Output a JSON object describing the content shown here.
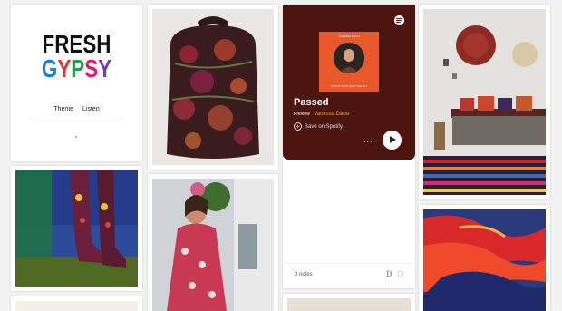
{
  "brand": {
    "line1": "FRESH",
    "line2_letters": [
      {
        "ch": "G",
        "color": "#1a7fd4"
      },
      {
        "ch": "Y",
        "color": "#e53131"
      },
      {
        "ch": "P",
        "color": "#2b9c4a"
      },
      {
        "ch": "S",
        "color": "#d71f7a"
      },
      {
        "ch": "Y",
        "color": "#6b3fb0"
      }
    ]
  },
  "nav": {
    "theme": "Theme",
    "listen": "Listen"
  },
  "spotify": {
    "album_top": "VANESSA DAOU",
    "album_bottom": "SUNNY DAYS FEAT THE HIT",
    "title": "Passed",
    "preview": "Preview",
    "artist": "Vanessa Daou",
    "save": "Save on Spotify",
    "more": "...",
    "accent": "#4c1510"
  },
  "post": {
    "notes": "3 notes",
    "reblog_glyph": "D"
  }
}
